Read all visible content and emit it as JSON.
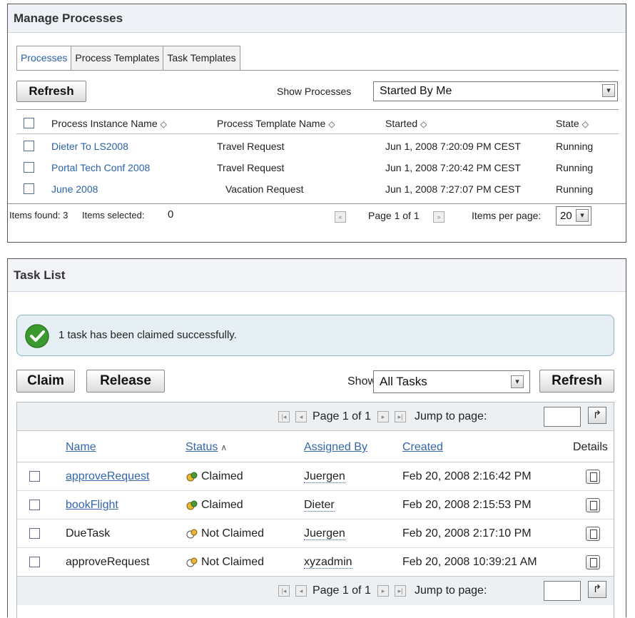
{
  "processes_panel": {
    "title": "Manage Processes",
    "tabs": [
      "Processes",
      "Process Templates",
      "Task Templates"
    ],
    "refresh_label": "Refresh",
    "show_label": "Show Processes",
    "show_value": "Started By Me",
    "columns": [
      "Process Instance Name",
      "Process Template Name",
      "Started",
      "State"
    ],
    "rows": [
      {
        "name": "Dieter To LS2008",
        "template": "Travel Request",
        "started": "Jun 1, 2008 7:20:09 PM CEST",
        "state": "Running"
      },
      {
        "name": "Portal Tech Conf 2008",
        "template": "Travel Request",
        "started": "Jun 1, 2008 7:20:42 PM CEST",
        "state": "Running"
      },
      {
        "name": "June 2008",
        "template": "Vacation Request",
        "started": "Jun 1, 2008 7:27:07 PM CEST",
        "state": "Running"
      }
    ],
    "footer": {
      "items_found": "Items found: 3",
      "items_selected_label": "Items selected:",
      "items_selected_value": "0",
      "page": "Page 1 of 1",
      "items_per_page_label": "Items per page:",
      "items_per_page_value": "20"
    }
  },
  "tasks_panel": {
    "title": "Task List",
    "message": "1 task has been claimed successfully.",
    "claim_label": "Claim",
    "release_label": "Release",
    "show_label": "Show",
    "show_value": "All Tasks",
    "refresh_label": "Refresh",
    "page": "Page 1 of 1",
    "jump_label": "Jump to page:",
    "columns": [
      "Name",
      "Status",
      "Assigned By",
      "Created",
      "Details"
    ],
    "rows": [
      {
        "name": "approveRequest",
        "status": "Claimed",
        "assigned_by": "Juergen",
        "created": "Feb 20, 2008 2:16:42 PM"
      },
      {
        "name": "bookFlight",
        "status": "Claimed",
        "assigned_by": "Dieter",
        "created": "Feb 20, 2008 2:15:53 PM"
      },
      {
        "name": "DueTask",
        "status": "Not Claimed",
        "assigned_by": "Juergen",
        "created": "Feb 20, 2008 2:17:10 PM"
      },
      {
        "name": "approveRequest",
        "status": "Not Claimed",
        "assigned_by": "xyzadmin",
        "created": "Feb 20, 2008 10:39:21 AM"
      }
    ]
  },
  "colors": {
    "link": "#2a62a8",
    "success": "#3a9a2e",
    "message_bg": "#e6f0f4"
  }
}
